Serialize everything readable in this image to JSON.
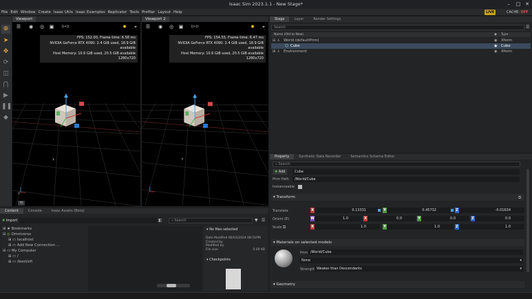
{
  "window": {
    "title": "Isaac Sim 2023.1.1 - New Stage*",
    "minimize": "–",
    "maximize": "□",
    "close": "✕"
  },
  "menu": [
    "File",
    "Edit",
    "Window",
    "Create",
    "Isaac Utils",
    "Isaac Examples",
    "Replicator",
    "Tools",
    "Profiler",
    "Layout",
    "Help"
  ],
  "status": {
    "live": "LIVE",
    "cache_label": "CACHE:",
    "cache_state": "OFF"
  },
  "viewports": [
    {
      "tab": "Viewport",
      "fps": "FPS: 152.00, Frame time: 6.58 ms",
      "gpu": "NVIDIA GeForce RTX 4090: 2.4 GiB used, 18.9 GiB available",
      "host": "Host Memory: 10.6 GiB used, 20.5 GiB available",
      "res": "1280x720"
    },
    {
      "tab": "Viewport 2",
      "fps": "FPS: 154.55, Frame time: 6.47 ms",
      "gpu": "NVIDIA GeForce RTX 4090: 2.4 GiB used, 18.9 GiB available",
      "host": "Host Memory: 10.6 GiB used, 20.5 GiB available",
      "res": "1280x720"
    }
  ],
  "stage": {
    "tabs": [
      "Stage",
      "Layer",
      "Render Settings"
    ],
    "search_placeholder": "Search",
    "col_name": "Name (Old to New)",
    "col_type": "Type",
    "rows": [
      {
        "name": "World (defaultPrim)",
        "type": "Xform"
      },
      {
        "name": "Cube",
        "type": "Cube"
      },
      {
        "name": "Environment",
        "type": "Xform"
      }
    ]
  },
  "property": {
    "tabs": [
      "Property",
      "Synthetic Data Recorder",
      "Semantics Schema Editor"
    ],
    "search_placeholder": "Search",
    "add": "Add",
    "name_value": "Cube",
    "prim_path_label": "Prim Path",
    "prim_path": "/World/Cube",
    "instanceable_label": "Instanceable",
    "transform": "Transform",
    "translate_label": "Translate",
    "translate": [
      "0.13331",
      "0.45732",
      "-0.01634"
    ],
    "orient_label": "Orient (E)",
    "orient": [
      "1.0",
      "0.0",
      "0.0",
      "0.0"
    ],
    "scale_label": "Scale",
    "scale": [
      "1.0",
      "1.0",
      "1.0"
    ],
    "materials": "Materials on selected models",
    "material_prim_label": "Prim",
    "material_prim": "/World/Cube",
    "material_value": "None",
    "strength_label": "Strength",
    "strength_value": "Weaker than Descendants",
    "geometry": "Geometry"
  },
  "content": {
    "tabs": [
      "Content",
      "Console",
      "Isaac Assets (Beta)"
    ],
    "import": "Import",
    "search_placeholder": "Search",
    "tree": [
      "Bookmarks",
      "Omniverse",
      "localhost",
      "Add New Connection ...",
      "My Computer",
      "/",
      "/boot/efi"
    ],
    "no_files": "No files selected",
    "meta": {
      "date_modified": "Date Modified 06/01/2024 08:51PM",
      "created_by": "Created by",
      "modified_by": "Modified by",
      "file_size_label": "File size",
      "file_size": "0.00 KB"
    },
    "checkpoints": "Checkpoints"
  }
}
